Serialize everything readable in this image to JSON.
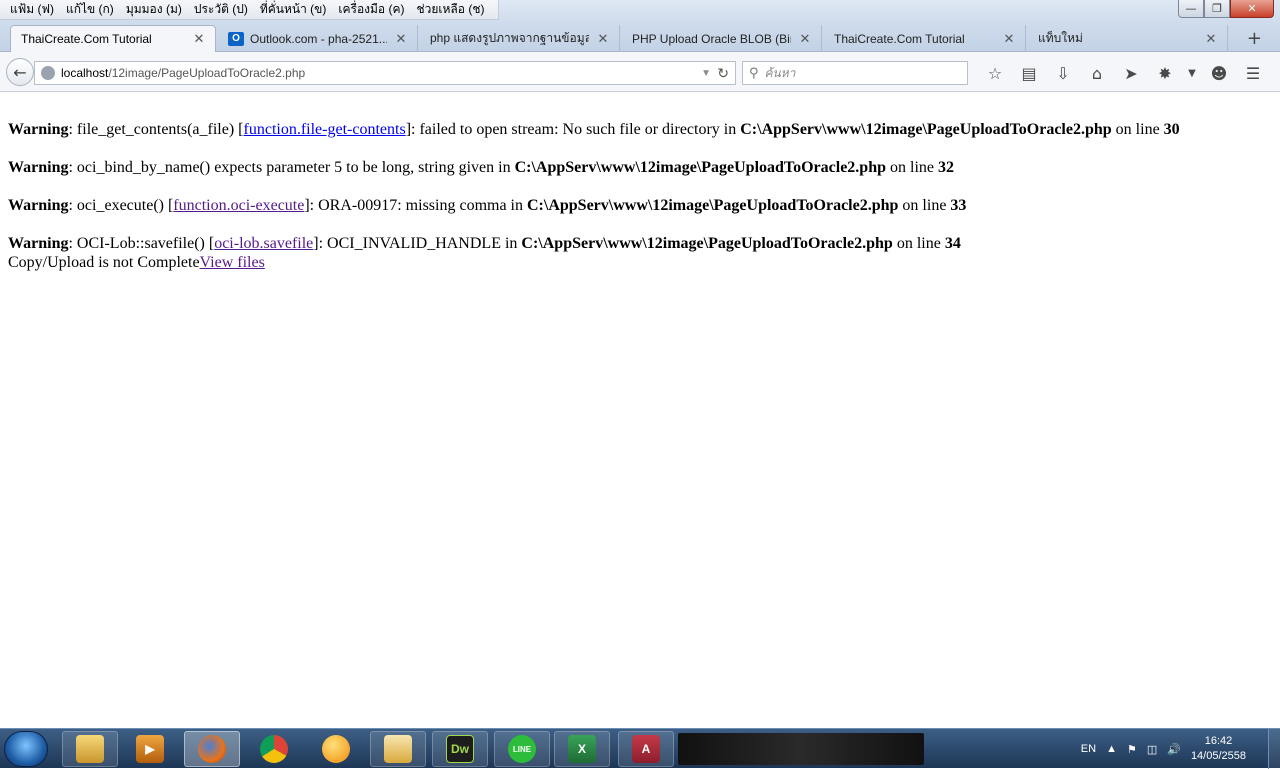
{
  "menu": {
    "items": [
      "แฟ้ม (ฟ)",
      "แก้ไข (ก)",
      "มุมมอง (ม)",
      "ประวัติ (ป)",
      "ที่คั่นหน้า (ข)",
      "เครื่องมือ (ค)",
      "ช่วยเหลือ (ช)"
    ]
  },
  "tabs": [
    {
      "title": "ThaiCreate.Com Tutorial",
      "active": true
    },
    {
      "title": "Outlook.com - pha-2521...",
      "active": false,
      "favicon_letter": "O"
    },
    {
      "title": "php แสดงรูปภาพจากฐานข้อมูล ...",
      "active": false
    },
    {
      "title": "PHP Upload Oracle BLOB (Bin...",
      "active": false
    },
    {
      "title": "ThaiCreate.Com Tutorial",
      "active": false
    },
    {
      "title": "แท็บใหม่",
      "active": false
    }
  ],
  "navbar": {
    "url_host": "localhost",
    "url_path": "/12image/PageUploadToOracle2.php",
    "search_placeholder": "ค้นหา"
  },
  "content": {
    "warning_label": "Warning",
    "w1": {
      "pre": ": file_get_contents(a_file) [",
      "link": "function.file-get-contents",
      "post": "]: failed to open stream: No such file or directory in ",
      "file": "C:\\AppServ\\www\\12image\\PageUploadToOracle2.php",
      "online": " on line ",
      "line": "30"
    },
    "w2": {
      "pre": ": oci_bind_by_name() expects parameter 5 to be long, string given in ",
      "file": "C:\\AppServ\\www\\12image\\PageUploadToOracle2.php",
      "online": " on line ",
      "line": "32"
    },
    "w3": {
      "pre": ": oci_execute() [",
      "link": "function.oci-execute",
      "post": "]: ORA-00917: missing comma in ",
      "file": "C:\\AppServ\\www\\12image\\PageUploadToOracle2.php",
      "online": " on line ",
      "line": "33"
    },
    "w4": {
      "pre": ": OCI-Lob::savefile() [",
      "link": "oci-lob.savefile",
      "post": "]: OCI_INVALID_HANDLE in ",
      "file": "C:\\AppServ\\www\\12image\\PageUploadToOracle2.php",
      "online": " on line ",
      "line": "34"
    },
    "status_text": "Copy/Upload is not Complete",
    "view_files_link": "View files"
  },
  "taskbar": {
    "apps": [
      {
        "name": "Windows Explorer",
        "icon": "folder-icon"
      },
      {
        "name": "Media Player",
        "icon": "media-player-icon"
      },
      {
        "name": "Firefox",
        "icon": "firefox-icon"
      },
      {
        "name": "Chrome",
        "icon": "chrome-icon"
      },
      {
        "name": "Messenger",
        "icon": "messenger-icon"
      },
      {
        "name": "Outlook",
        "icon": "outlook-icon"
      },
      {
        "name": "Dreamweaver",
        "icon": "dreamweaver-icon",
        "label": "Dw"
      },
      {
        "name": "LINE",
        "icon": "line-icon",
        "label": "LINE"
      },
      {
        "name": "Excel",
        "icon": "excel-icon",
        "label": "X"
      },
      {
        "name": "Access",
        "icon": "access-icon",
        "label": "A"
      }
    ],
    "tray": {
      "language": "EN",
      "time": "16:42",
      "date": "14/05/2558"
    }
  },
  "colors": {
    "link_visited": "#551a8b",
    "link_unvisited": "#0000ee",
    "taskbar": "#2a4a70",
    "close_button": "#c7402a"
  }
}
